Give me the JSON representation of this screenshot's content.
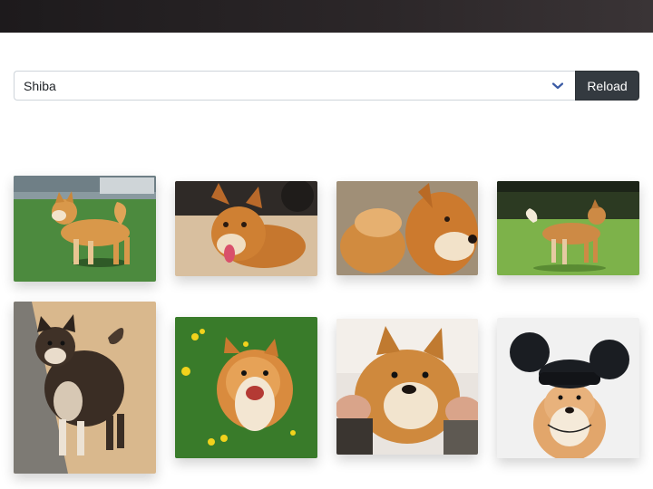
{
  "breed_select": {
    "selected": "Shiba"
  },
  "reload_button": {
    "label": "Reload"
  },
  "gallery": {
    "images": [
      {
        "subject": "shiba-standing-on-grass"
      },
      {
        "subject": "shiba-tongue-out"
      },
      {
        "subject": "shiba-closeup-profile"
      },
      {
        "subject": "shiba-on-lawn"
      },
      {
        "subject": "black-and-tan-shiba"
      },
      {
        "subject": "shiba-lying-on-grass-flowers"
      },
      {
        "subject": "shiba-cheeks-squeezed"
      },
      {
        "subject": "shiba-with-mouse-ears-hat"
      }
    ]
  },
  "colors": {
    "topbar": "#2c2729",
    "button": "#343a40",
    "chevron": "#3b5ba5"
  }
}
